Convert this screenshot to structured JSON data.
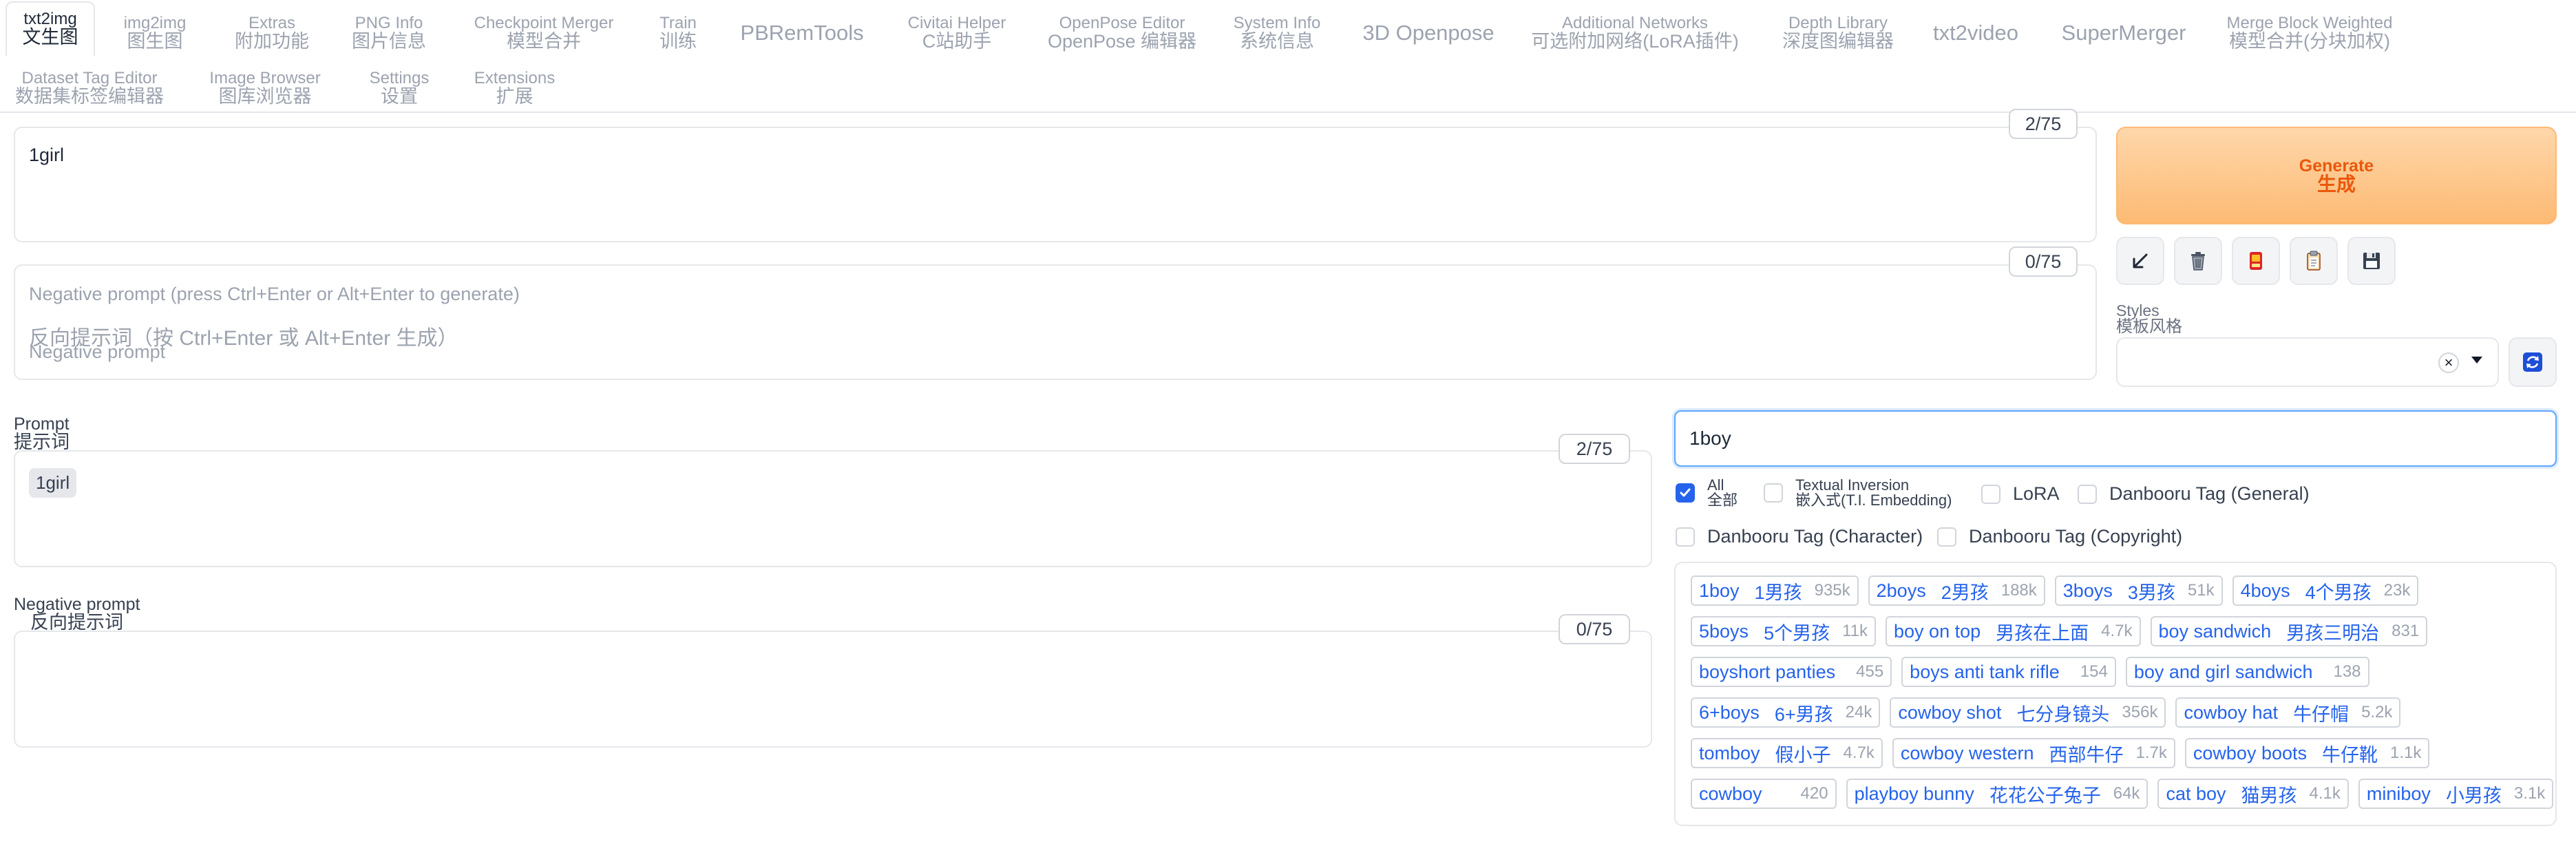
{
  "tabs": [
    {
      "en": "txt2img",
      "zh": "文生图",
      "active": true
    },
    {
      "en": "img2img",
      "zh": "图生图"
    },
    {
      "en": "Extras",
      "zh": "附加功能"
    },
    {
      "en": "PNG Info",
      "zh": "图片信息"
    },
    {
      "en": "Checkpoint Merger",
      "zh": "模型合并"
    },
    {
      "en": "Train",
      "zh": "训练"
    },
    {
      "en": "PBRemTools"
    },
    {
      "en": "Civitai Helper",
      "zh": "C站助手"
    },
    {
      "en": "OpenPose Editor",
      "zh": "OpenPose 编辑器"
    },
    {
      "en": "System Info",
      "zh": "系统信息"
    },
    {
      "en": "3D Openpose"
    },
    {
      "en": "Additional Networks",
      "zh": "可选附加网络(LoRA插件)"
    },
    {
      "en": "Depth Library",
      "zh": "深度图编辑器"
    },
    {
      "en": "txt2video"
    },
    {
      "en": "SuperMerger"
    },
    {
      "en": "Merge Block Weighted",
      "zh": "模型合并(分块加权)"
    },
    {
      "en": "Dataset Tag Editor",
      "zh": "数据集标签编辑器"
    },
    {
      "en": "Image Browser",
      "zh": "图库浏览器"
    },
    {
      "en": "Settings",
      "zh": "设置"
    },
    {
      "en": "Extensions",
      "zh": "扩展"
    }
  ],
  "top_prompt": {
    "value": "1girl",
    "counter": "2/75"
  },
  "top_negative": {
    "counter": "0/75",
    "placeholder_en": "Negative prompt (press Ctrl+Enter or Alt+Enter to generate)",
    "placeholder_zh": "反向提示词（按 Ctrl+Enter 或 Alt+Enter 生成）",
    "placeholder_label": "Negative prompt"
  },
  "generate": {
    "en": "Generate",
    "zh": "生成"
  },
  "tool_icons": [
    "arrow-icon",
    "trash-icon",
    "red-card-icon",
    "clipboard-icon",
    "save-icon"
  ],
  "styles": {
    "en": "Styles",
    "zh": "模板风格",
    "clear": "×"
  },
  "prompt_panel": {
    "label_en": "Prompt",
    "label_zh": "提示词",
    "counter": "2/75",
    "chip": "1girl"
  },
  "negative_panel": {
    "label_en": "Negative prompt",
    "label_zh": "反向提示词",
    "counter": "0/75"
  },
  "tag_search": {
    "value": "1boy",
    "filters": [
      {
        "en": "All",
        "zh": "全部",
        "checked": true
      },
      {
        "en": "Textual Inversion",
        "zh": "嵌入式(T.I. Embedding)",
        "checked": false
      },
      {
        "en": "LoRA",
        "checked": false
      },
      {
        "en": "Danbooru Tag (General)",
        "checked": false
      },
      {
        "en": "Danbooru Tag (Character)",
        "checked": false
      },
      {
        "en": "Danbooru Tag (Copyright)",
        "checked": false
      }
    ],
    "rows": [
      [
        {
          "name": "1boy",
          "zh": "1男孩",
          "count": "935k"
        },
        {
          "name": "2boys",
          "zh": "2男孩",
          "count": "188k"
        },
        {
          "name": "3boys",
          "zh": "3男孩",
          "count": "51k"
        },
        {
          "name": "4boys",
          "zh": "4个男孩",
          "count": "23k"
        }
      ],
      [
        {
          "name": "5boys",
          "zh": "5个男孩",
          "count": "11k"
        },
        {
          "name": "boy on top",
          "zh": "男孩在上面",
          "count": "4.7k"
        },
        {
          "name": "boy sandwich",
          "zh": "男孩三明治",
          "count": "831"
        }
      ],
      [
        {
          "name": "boyshort panties",
          "count": "455"
        },
        {
          "name": "boys anti tank rifle",
          "count": "154"
        },
        {
          "name": "boy and girl sandwich",
          "count": "138"
        }
      ],
      [
        {
          "name": "6+boys",
          "zh": "6+男孩",
          "count": "24k"
        },
        {
          "name": "cowboy shot",
          "zh": "七分身镜头",
          "count": "356k"
        },
        {
          "name": "cowboy hat",
          "zh": "牛仔帽",
          "count": "5.2k"
        }
      ],
      [
        {
          "name": "tomboy",
          "zh": "假小子",
          "count": "4.7k"
        },
        {
          "name": "cowboy western",
          "zh": "西部牛仔",
          "count": "1.7k"
        },
        {
          "name": "cowboy boots",
          "zh": "牛仔靴",
          "count": "1.1k"
        }
      ],
      [
        {
          "name": "cowboy",
          "count": "420"
        },
        {
          "name": "playboy bunny",
          "zh": "花花公子兔子",
          "count": "64k"
        },
        {
          "name": "cat boy",
          "zh": "猫男孩",
          "count": "4.1k"
        },
        {
          "name": "miniboy",
          "zh": "小男孩",
          "count": "3.1k"
        }
      ]
    ]
  },
  "colors": {
    "accent": "#2563eb",
    "generate_bg": "#fdba74",
    "generate_text": "#ea580c"
  }
}
